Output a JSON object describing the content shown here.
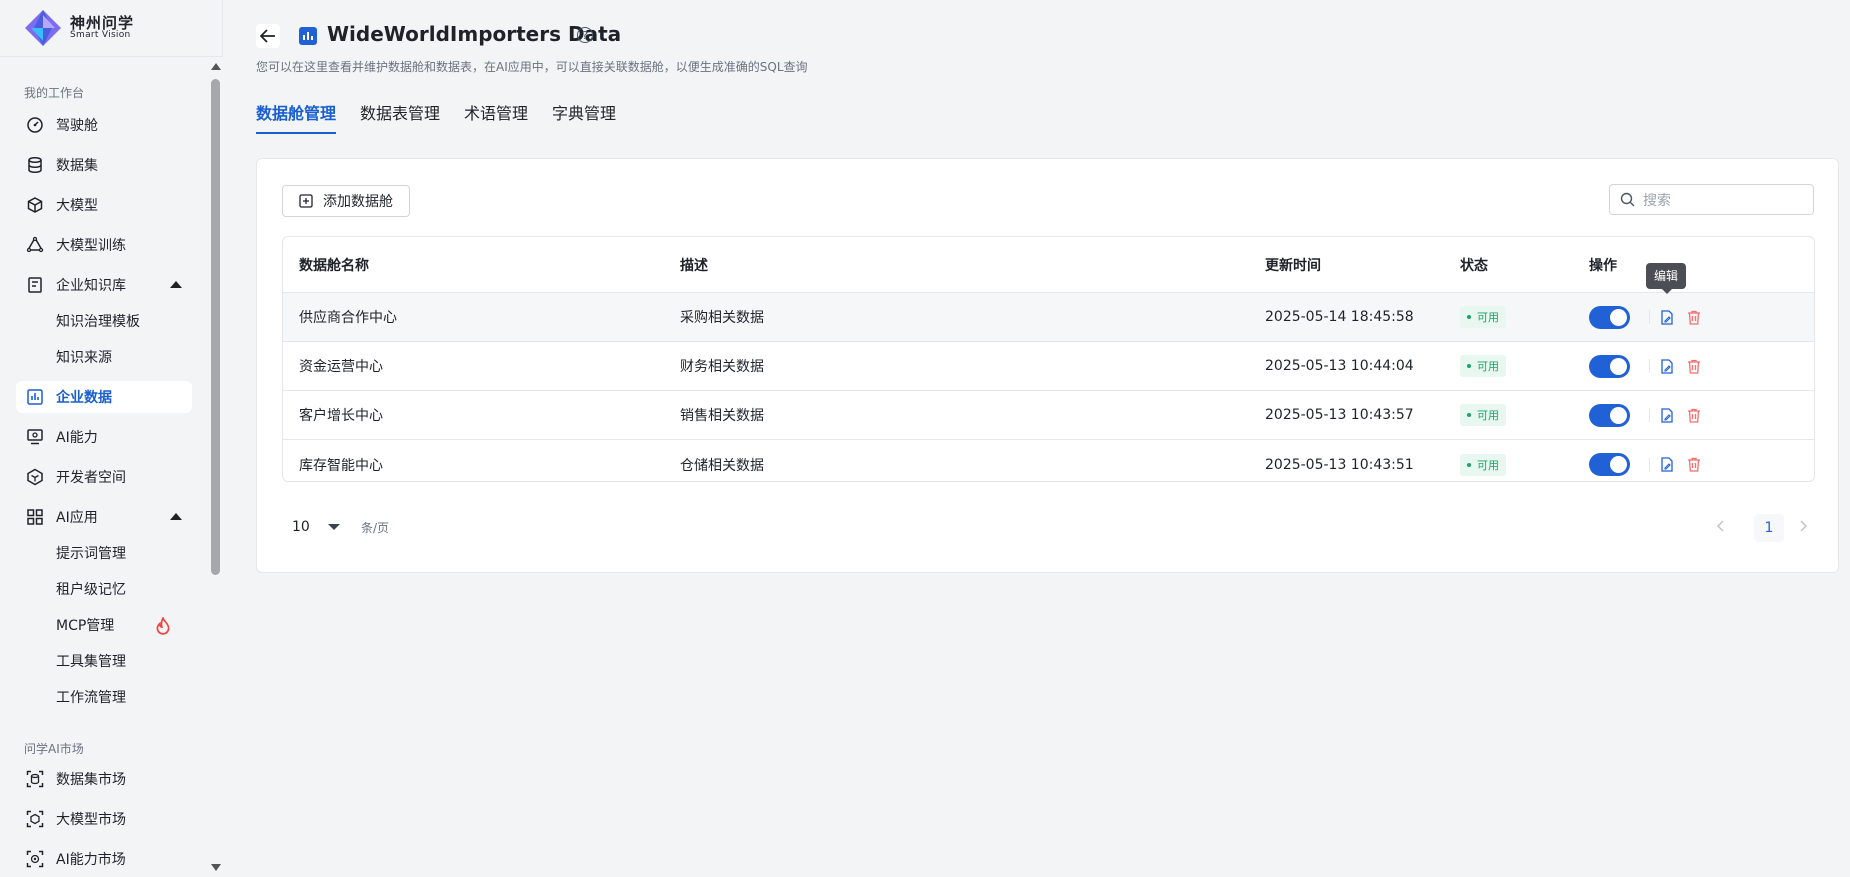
{
  "app": {
    "name_cn": "神州问学",
    "name_en": "Smart Vision"
  },
  "sidebar": {
    "group1_title": "我的工作台",
    "items": [
      {
        "label": "驾驶舱",
        "icon": "dashboard-icon"
      },
      {
        "label": "数据集",
        "icon": "database-icon"
      },
      {
        "label": "大模型",
        "icon": "cube-icon"
      },
      {
        "label": "大模型训练",
        "icon": "training-icon"
      },
      {
        "label": "企业知识库",
        "icon": "knowledge-icon"
      },
      {
        "label": "知识治理模板",
        "icon": ""
      },
      {
        "label": "知识来源",
        "icon": ""
      },
      {
        "label": "企业数据",
        "icon": "chart-icon"
      },
      {
        "label": "AI能力",
        "icon": "monitor-icon"
      },
      {
        "label": "开发者空间",
        "icon": "box-icon"
      },
      {
        "label": "AI应用",
        "icon": "grid-icon"
      },
      {
        "label": "提示词管理",
        "icon": ""
      },
      {
        "label": "租户级记忆",
        "icon": ""
      },
      {
        "label": "MCP管理",
        "icon": ""
      },
      {
        "label": "工具集管理",
        "icon": ""
      },
      {
        "label": "工作流管理",
        "icon": ""
      }
    ],
    "group2_title": "问学AI市场",
    "market_items": [
      {
        "label": "数据集市场",
        "icon": "scan-database-icon"
      },
      {
        "label": "大模型市场",
        "icon": "scan-cube-icon"
      },
      {
        "label": "AI能力市场",
        "icon": "scan-ai-icon"
      }
    ]
  },
  "header": {
    "title": "WideWorldImporters Data",
    "help": "?",
    "description": "您可以在这里查看并维护数据舱和数据表，在AI应用中，可以直接关联数据舱，以便生成准确的SQL查询"
  },
  "tabs": [
    {
      "label": "数据舱管理",
      "active": true
    },
    {
      "label": "数据表管理",
      "active": false
    },
    {
      "label": "术语管理",
      "active": false
    },
    {
      "label": "字典管理",
      "active": false
    }
  ],
  "toolbar": {
    "add_label": "添加数据舱",
    "search_placeholder": "搜索"
  },
  "table": {
    "columns": [
      "数据舱名称",
      "描述",
      "更新时间",
      "状态",
      "操作"
    ],
    "rows": [
      {
        "name": "供应商合作中心",
        "desc": "采购相关数据",
        "updated": "2025-05-14 18:45:58",
        "status": "可用",
        "enabled": true
      },
      {
        "name": "资金运营中心",
        "desc": "财务相关数据",
        "updated": "2025-05-13 10:44:04",
        "status": "可用",
        "enabled": true
      },
      {
        "name": "客户增长中心",
        "desc": "销售相关数据",
        "updated": "2025-05-13 10:43:57",
        "status": "可用",
        "enabled": true
      },
      {
        "name": "库存智能中心",
        "desc": "仓储相关数据",
        "updated": "2025-05-13 10:43:51",
        "status": "可用",
        "enabled": true
      }
    ]
  },
  "tooltip": "编辑",
  "pagination": {
    "page_size": "10",
    "per_page_label": "条/页",
    "current_page": "1"
  },
  "colors": {
    "primary": "#2161d6",
    "success": "#1aa36b",
    "danger": "#f56c6c"
  }
}
